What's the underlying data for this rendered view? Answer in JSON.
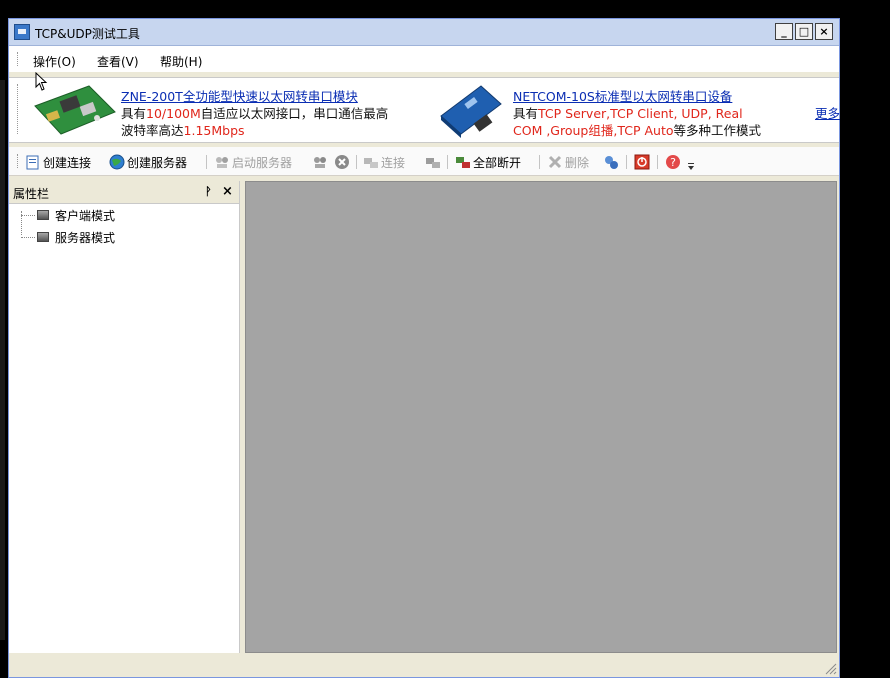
{
  "window": {
    "title": "TCP&UDP测试工具",
    "min_label": "_",
    "max_label": "□",
    "close_label": "×"
  },
  "menu": {
    "items": [
      "操作(O)",
      "查看(V)",
      "帮助(H)"
    ]
  },
  "banner": {
    "product1": {
      "title": "ZNE-200T全功能型快速以太网转串口模块",
      "line1_a": "具有",
      "line1_red": "10/100M",
      "line1_b": "自适应以太网接口，串口通信最高",
      "line2_a": "波特率高达",
      "line2_red": "1.15Mbps"
    },
    "product2": {
      "title": "NETCOM-10S标准型以太网转串口设备",
      "line1_a": "具有",
      "line1_red": "TCP Server,TCP Client, UDP, Real",
      "line2_red": "COM ,Group组播,TCP Auto",
      "line2_b": "等多种工作模式"
    },
    "more": "更多"
  },
  "toolbar": {
    "create_connection": "创建连接",
    "create_server": "创建服务器",
    "start_server": "启动服务器",
    "connect": "连接",
    "disconnect_all": "全部断开",
    "delete": "删除"
  },
  "panel": {
    "title": "属性栏",
    "pin": "ᚹ",
    "close": "×",
    "items": [
      "客户端模式",
      "服务器模式"
    ]
  },
  "colors": {
    "title_bg": "#c7d6ef",
    "link": "#0b2eb3",
    "highlight": "#e0261b",
    "mdi_bg": "#a4a4a4"
  }
}
